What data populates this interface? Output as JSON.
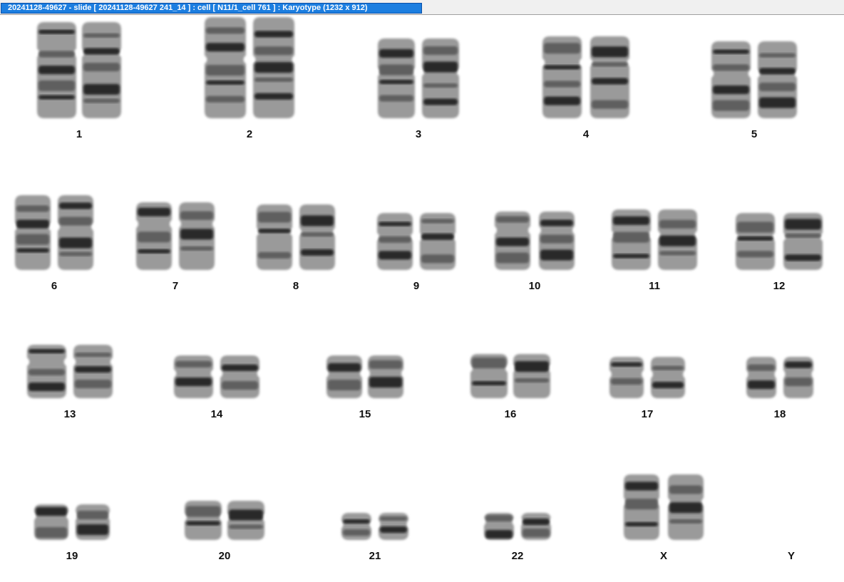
{
  "window": {
    "title": "20241128-49627 - slide [ 20241128-49627 241_14 ] : cell [ N11/1_cell 761 ] : Karyotype  (1232 x 912)"
  },
  "karyotype": {
    "colors": {
      "chromosome_dark": "#151515",
      "chromosome_mid": "#555555",
      "chromosome_light": "#9a9a9a",
      "background": "#ffffff"
    },
    "pairs": [
      {
        "label": "1",
        "present": true
      },
      {
        "label": "2",
        "present": true
      },
      {
        "label": "3",
        "present": true
      },
      {
        "label": "4",
        "present": true
      },
      {
        "label": "5",
        "present": true
      },
      {
        "label": "6",
        "present": true
      },
      {
        "label": "7",
        "present": true
      },
      {
        "label": "8",
        "present": true
      },
      {
        "label": "9",
        "present": true
      },
      {
        "label": "10",
        "present": true
      },
      {
        "label": "11",
        "present": true
      },
      {
        "label": "12",
        "present": true
      },
      {
        "label": "13",
        "present": true
      },
      {
        "label": "14",
        "present": true
      },
      {
        "label": "15",
        "present": true
      },
      {
        "label": "16",
        "present": true
      },
      {
        "label": "17",
        "present": true
      },
      {
        "label": "18",
        "present": true
      },
      {
        "label": "19",
        "present": true
      },
      {
        "label": "20",
        "present": true
      },
      {
        "label": "21",
        "present": true
      },
      {
        "label": "22",
        "present": true
      },
      {
        "label": "X",
        "present": true
      },
      {
        "label": "Y",
        "present": false
      }
    ]
  }
}
